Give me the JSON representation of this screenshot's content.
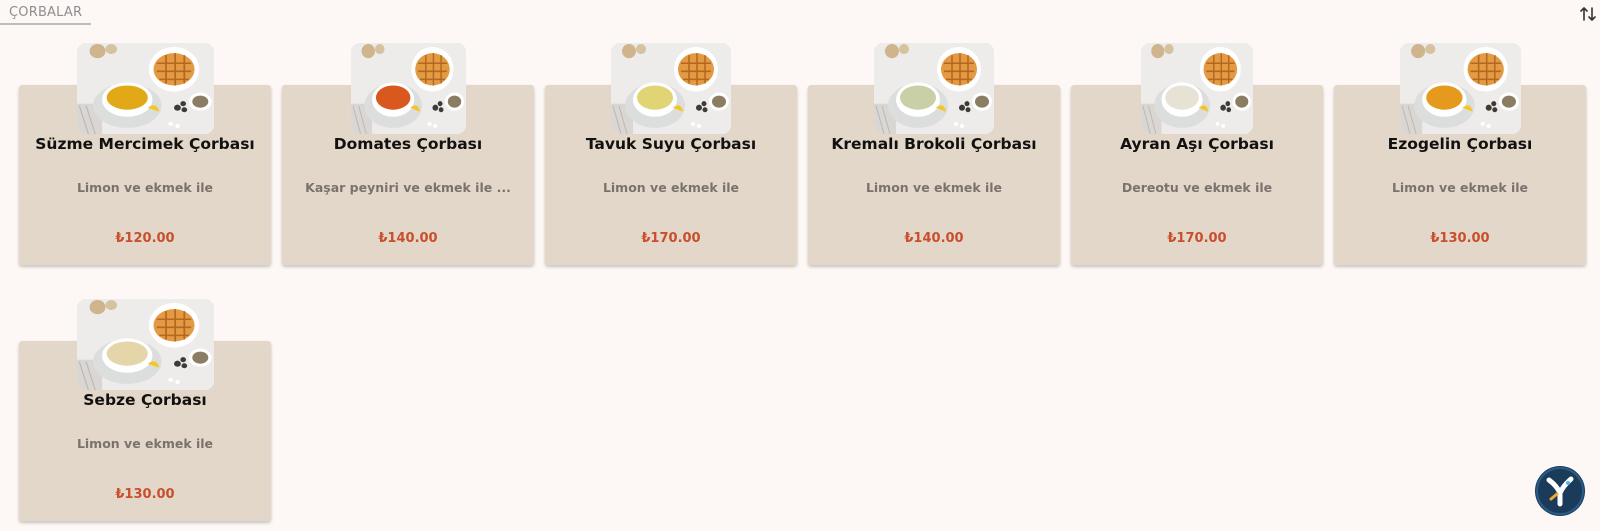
{
  "category_tab": {
    "label": "ÇORBALAR"
  },
  "sort": {
    "icon": "sort-arrows-icon"
  },
  "products": [
    {
      "name": "Süzme Mercimek Çorbası",
      "description": "Limon ve ekmek ile",
      "price": "₺120.00",
      "soup_color": "#e2a818"
    },
    {
      "name": "Domates Çorbası",
      "description": "Kaşar peyniri ve ekmek ile ...",
      "price": "₺140.00",
      "soup_color": "#d8581e"
    },
    {
      "name": "Tavuk Suyu Çorbası",
      "description": "Limon ve ekmek ile",
      "price": "₺170.00",
      "soup_color": "#e0d474"
    },
    {
      "name": "Kremalı Brokoli Çorbası",
      "description": "Limon ve ekmek ile",
      "price": "₺140.00",
      "soup_color": "#c9cfa6"
    },
    {
      "name": "Ayran Aşı Çorbası",
      "description": "Dereotu ve ekmek ile",
      "price": "₺170.00",
      "soup_color": "#e6e2d4"
    },
    {
      "name": "Ezogelin Çorbası",
      "description": "Limon ve ekmek ile",
      "price": "₺130.00",
      "soup_color": "#e59a1e"
    },
    {
      "name": "Sebze Çorbası",
      "description": "Limon ve ekmek ile",
      "price": "₺130.00",
      "soup_color": "#e4d6a8"
    }
  ],
  "fab": {
    "icon": "app-logo-icon"
  }
}
